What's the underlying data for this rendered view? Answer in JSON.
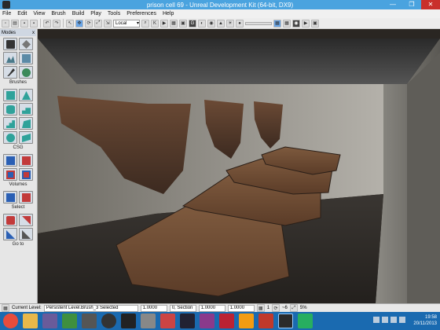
{
  "window": {
    "title": "prison cell 69 - Unreal Development Kit (64-bit, DX9)",
    "minimize": "—",
    "maximize": "❐",
    "close": "✕"
  },
  "menu": [
    "File",
    "Edit",
    "View",
    "Brush",
    "Build",
    "Play",
    "Tools",
    "Preferences",
    "Help"
  ],
  "toolbar": {
    "coord_system": "Local"
  },
  "modes_panel": {
    "title": "Modes",
    "close": "x",
    "sections": {
      "brushes": "Brushes",
      "csg": "CSG",
      "volumes": "Volumes",
      "select": "Select",
      "go_to": "Go to"
    }
  },
  "statusbar": {
    "current_level_label": "Current Level:",
    "current_level_value": "Persistent Level.Brush_3 Selected",
    "field2": "1.0000",
    "field3": "0, Section",
    "field4": "1.0000",
    "field5": "1.0000",
    "grid_value": "1",
    "snap_value": "~6",
    "percent": "5%"
  },
  "taskbar": {
    "time": "19:58",
    "date": "20/11/2013"
  },
  "colors": {
    "taskbar": "#1a6ab0",
    "titlebar": "#4aa3df",
    "toolbar": "#ececec"
  }
}
